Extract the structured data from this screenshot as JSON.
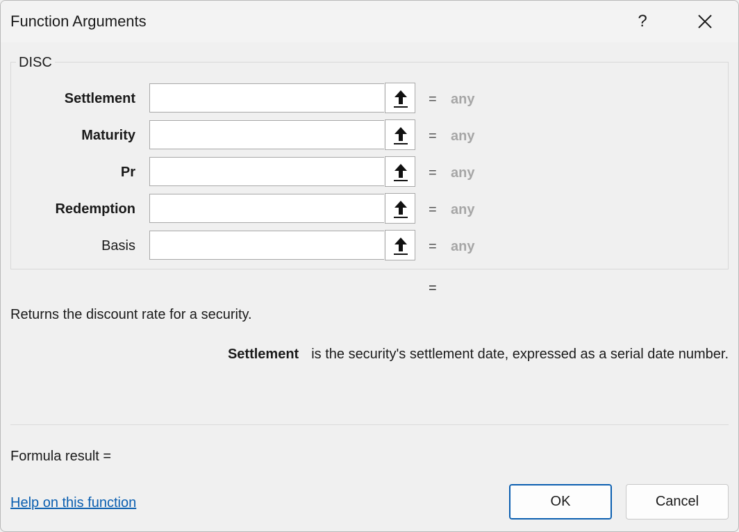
{
  "window": {
    "title": "Function Arguments",
    "help_glyph": "?",
    "close_icon": "close-icon"
  },
  "function_group": {
    "name": "DISC",
    "arguments": [
      {
        "label": "Settlement",
        "bold": true,
        "value": "",
        "equals": "=",
        "result": "any"
      },
      {
        "label": "Maturity",
        "bold": true,
        "value": "",
        "equals": "=",
        "result": "any"
      },
      {
        "label": "Pr",
        "bold": true,
        "value": "",
        "equals": "=",
        "result": "any"
      },
      {
        "label": "Redemption",
        "bold": true,
        "value": "",
        "equals": "=",
        "result": "any"
      },
      {
        "label": "Basis",
        "bold": false,
        "value": "",
        "equals": "=",
        "result": "any"
      }
    ]
  },
  "function_result_equals": "=",
  "description": "Returns the discount rate for a security.",
  "argument_help": {
    "name": "Settlement",
    "text": "is the security's settlement date, expressed as a serial date number."
  },
  "formula_result": "Formula result =",
  "help_link": "Help on this function",
  "buttons": {
    "ok": "OK",
    "cancel": "Cancel"
  },
  "colors": {
    "accent": "#0a5eb0",
    "placeholder_result": "#a6a6a6"
  }
}
